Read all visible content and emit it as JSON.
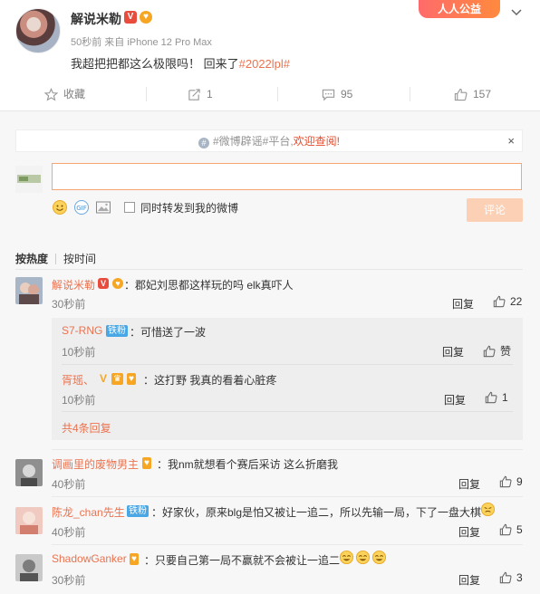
{
  "post": {
    "author": "解说米勒",
    "meta": "50秒前 来自 iPhone 12 Pro Max",
    "text": "我超把把都这么极限吗！ 回来了",
    "tag": "#2022lpl#",
    "public_badge": "人人公益",
    "actions": {
      "favorite": "收藏",
      "forward": "1",
      "comment": "95",
      "like": "157"
    }
  },
  "composer": {
    "notice_prefix": "#微博辟谣#平台,",
    "notice_link": "欢迎查阅!",
    "notice_close": "×",
    "forward_label": "同时转发到我的微博",
    "submit": "评论"
  },
  "sort": {
    "hot": "按热度",
    "time": "按时间"
  },
  "comments": [
    {
      "name": "解说米勒",
      "text": "：郡妃刘思都这样玩的吗 elk真吓人",
      "time": "30秒前",
      "reply": "回复",
      "likes": "22",
      "subreplies": [
        {
          "name": "S7-RNG",
          "badge": "铁粉",
          "text": "：可惜送了一波",
          "time": "10秒前",
          "reply": "回复",
          "likes": "赞"
        },
        {
          "name": "胥瑶、",
          "badge": "V",
          "text": "：这打野 我真的看着心脏疼",
          "time": "10秒前",
          "reply": "回复",
          "likes": "1"
        }
      ],
      "more": "共4条回复"
    },
    {
      "name": "调画里的废物男主",
      "text": "：我nm就想看个赛后采访 这么折磨我",
      "time": "40秒前",
      "reply": "回复",
      "likes": "9"
    },
    {
      "name": "陈龙_chan先生",
      "badge": "铁粉",
      "text": "：好家伙，原来blg是怕又被让一追二，所以先输一局，下了一盘大棋",
      "time": "40秒前",
      "reply": "回复",
      "likes": "5"
    },
    {
      "name": "ShadowGanker",
      "text": "：只要自己第一局不赢就不会被让一追二",
      "time": "30秒前",
      "reply": "回复",
      "likes": "3"
    }
  ],
  "colors": {
    "accent": "#eb7350",
    "link_red": "#e34d2e",
    "submit_disabled": "#fbd0b4"
  }
}
